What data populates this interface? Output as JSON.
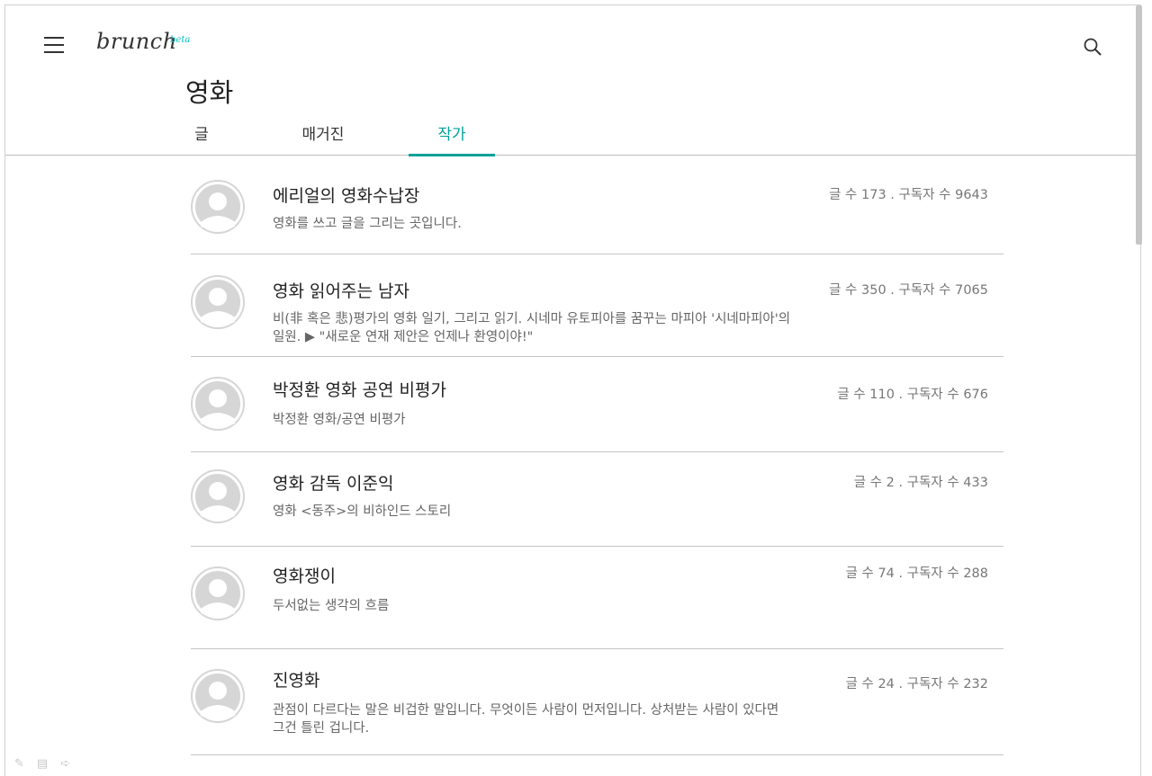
{
  "header": {
    "logo_text": "brunch",
    "logo_badge": "beta",
    "menu_icon": "hamburger-menu-icon",
    "search_icon": "search-icon"
  },
  "page": {
    "title": "영화"
  },
  "tabs": [
    {
      "label": "글",
      "active": false
    },
    {
      "label": "매거진",
      "active": false
    },
    {
      "label": "작가",
      "active": true
    }
  ],
  "accent_color": "#00a19a",
  "writers": [
    {
      "name": "에리얼의 영화수납장",
      "desc": "영화를 쓰고 글을 그리는 곳입니다.",
      "stats": "글 수 173 . 구독자 수 9643"
    },
    {
      "name": "영화 읽어주는 남자",
      "desc": "비(非 혹은 悲)평가의 영화 일기, 그리고 읽기. 시네마 유토피아를 꿈꾸는 마피아 '시네마피아'의 일원. ▶ \"새로운 연재 제안은 언제나 환영이야!\"",
      "stats": "글 수 350 . 구독자 수 7065"
    },
    {
      "name": "박정환 영화 공연 비평가",
      "desc": "박정환 영화/공연 비평가",
      "stats": "글 수 110 . 구독자 수 676"
    },
    {
      "name": "영화 감독 이준익",
      "desc": "영화 <동주>의 비하인드 스토리",
      "stats": "글 수 2 . 구독자 수 433"
    },
    {
      "name": "영화쟁이",
      "desc": "두서없는 생각의 흐름",
      "stats": "글 수 74 . 구독자 수 288"
    },
    {
      "name": "진영화",
      "desc": "관점이 다르다는 말은 비겁한 말입니다. 무엇이든 사람이 먼저입니다. 상처받는 사람이 있다면 그건 틀린 겁니다.",
      "stats": "글 수 24 . 구독자 수 232"
    }
  ]
}
